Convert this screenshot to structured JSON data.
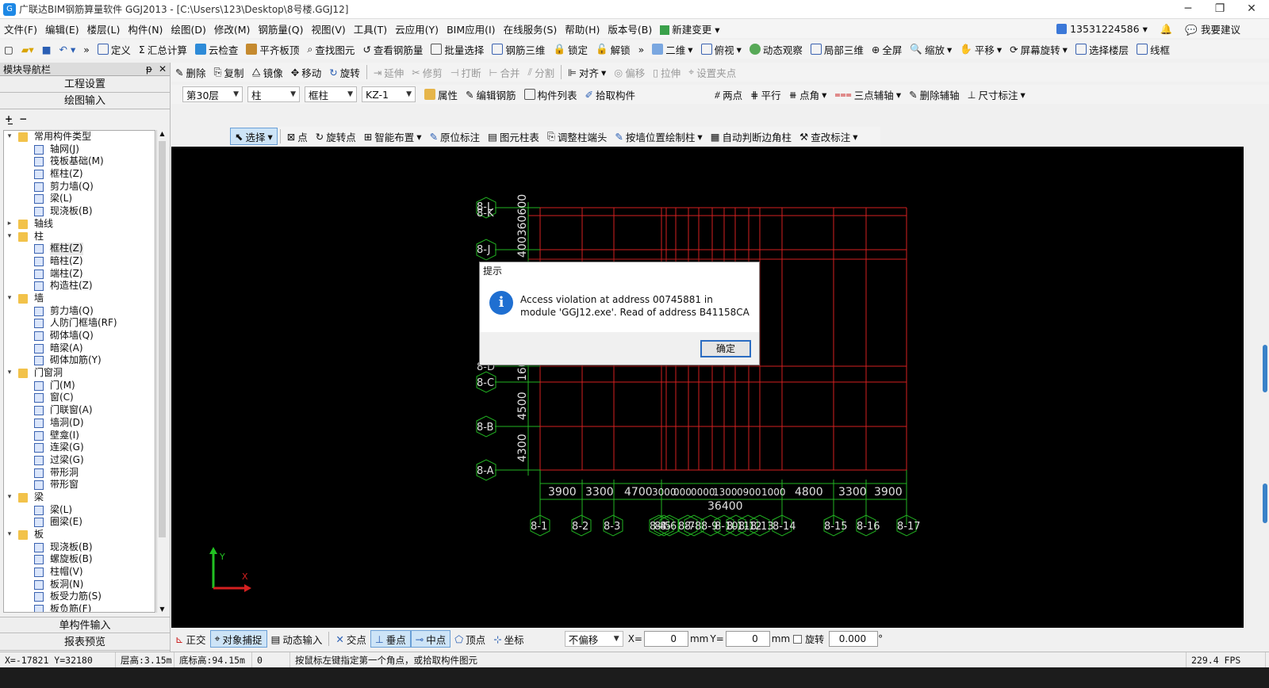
{
  "window": {
    "title": "广联达BIM钢筋算量软件 GGJ2013 - [C:\\Users\\123\\Desktop\\8号楼.GGJ12]",
    "minimize": "─",
    "restore": "❐",
    "close": "✕"
  },
  "menu": [
    "文件(F)",
    "编辑(E)",
    "楼层(L)",
    "构件(N)",
    "绘图(D)",
    "修改(M)",
    "钢筋量(Q)",
    "视图(V)",
    "工具(T)",
    "云应用(Y)",
    "BIM应用(I)",
    "在线服务(S)",
    "帮助(H)",
    "版本号(B)",
    "新建变更"
  ],
  "user": {
    "phone": "13531224586",
    "feedback": "我要建议"
  },
  "toolbar1": [
    "定义",
    "汇总计算",
    "云检查",
    "平齐板顶",
    "查找图元",
    "查看钢筋量",
    "批量选择",
    "钢筋三维",
    "锁定",
    "解锁",
    "二维",
    "俯视",
    "动态观察",
    "局部三维",
    "全屏",
    "缩放",
    "平移",
    "屏幕旋转",
    "选择楼层",
    "线框"
  ],
  "toolbar2": [
    "删除",
    "复制",
    "镜像",
    "移动",
    "旋转",
    "延伸",
    "修剪",
    "打断",
    "合并",
    "分割",
    "对齐",
    "偏移",
    "拉伸",
    "设置夹点"
  ],
  "toolbar3": {
    "floor": "第30层",
    "type": "柱",
    "subtype": "框柱",
    "element": "KZ-1",
    "buttons": [
      "属性",
      "编辑钢筋",
      "构件列表",
      "拾取构件"
    ],
    "axis_buttons": [
      "两点",
      "平行",
      "点角",
      "三点辅轴",
      "删除辅轴",
      "尺寸标注"
    ]
  },
  "toolbar4": [
    "选择",
    "点",
    "旋转点",
    "智能布置",
    "原位标注",
    "图元柱表",
    "调整柱端头",
    "按墙位置绘制柱",
    "自动判断边角柱",
    "查改标注"
  ],
  "leftpanel": {
    "title": "模块导航栏",
    "pin": "ᵽ",
    "close": "✕",
    "buttons_top": [
      "工程设置",
      "绘图输入"
    ],
    "buttons_bottom": [
      "单构件输入",
      "报表预览"
    ],
    "tree": [
      {
        "level": 0,
        "exp": "▾",
        "label": "常用构件类型",
        "folder": true
      },
      {
        "level": 1,
        "label": "轴网(J)"
      },
      {
        "level": 1,
        "label": "筏板基础(M)"
      },
      {
        "level": 1,
        "label": "框柱(Z)"
      },
      {
        "level": 1,
        "label": "剪力墙(Q)"
      },
      {
        "level": 1,
        "label": "梁(L)"
      },
      {
        "level": 1,
        "label": "现浇板(B)"
      },
      {
        "level": 0,
        "exp": "▸",
        "label": "轴线",
        "folder": true
      },
      {
        "level": 0,
        "exp": "▾",
        "label": "柱",
        "folder": true
      },
      {
        "level": 1,
        "label": "框柱(Z)",
        "selected": true
      },
      {
        "level": 1,
        "label": "暗柱(Z)"
      },
      {
        "level": 1,
        "label": "端柱(Z)"
      },
      {
        "level": 1,
        "label": "构造柱(Z)"
      },
      {
        "level": 0,
        "exp": "▾",
        "label": "墙",
        "folder": true
      },
      {
        "level": 1,
        "label": "剪力墙(Q)"
      },
      {
        "level": 1,
        "label": "人防门框墙(RF)"
      },
      {
        "level": 1,
        "label": "砌体墙(Q)"
      },
      {
        "level": 1,
        "label": "暗梁(A)"
      },
      {
        "level": 1,
        "label": "砌体加筋(Y)"
      },
      {
        "level": 0,
        "exp": "▾",
        "label": "门窗洞",
        "folder": true
      },
      {
        "level": 1,
        "label": "门(M)"
      },
      {
        "level": 1,
        "label": "窗(C)"
      },
      {
        "level": 1,
        "label": "门联窗(A)"
      },
      {
        "level": 1,
        "label": "墙洞(D)"
      },
      {
        "level": 1,
        "label": "壁龛(I)"
      },
      {
        "level": 1,
        "label": "连梁(G)"
      },
      {
        "level": 1,
        "label": "过梁(G)"
      },
      {
        "level": 1,
        "label": "带形洞"
      },
      {
        "level": 1,
        "label": "带形窗"
      },
      {
        "level": 0,
        "exp": "▾",
        "label": "梁",
        "folder": true
      },
      {
        "level": 1,
        "label": "梁(L)"
      },
      {
        "level": 1,
        "label": "圈梁(E)"
      },
      {
        "level": 0,
        "exp": "▾",
        "label": "板",
        "folder": true
      },
      {
        "level": 1,
        "label": "现浇板(B)"
      },
      {
        "level": 1,
        "label": "螺旋板(B)"
      },
      {
        "level": 1,
        "label": "柱帽(V)"
      },
      {
        "level": 1,
        "label": "板洞(N)"
      },
      {
        "level": 1,
        "label": "板受力筋(S)"
      },
      {
        "level": 1,
        "label": "板负筋(F)"
      }
    ]
  },
  "drawing": {
    "axis_top_dims_vertical": "400360600",
    "axis_left_labels": [
      "8-L",
      "8-K",
      "8-J",
      "8-D",
      "8-C",
      "8-B",
      "8-A"
    ],
    "left_dims": [
      "1600",
      "4500",
      "4300"
    ],
    "bottom_dims": [
      "3900",
      "3300",
      "4700",
      "3000",
      "000",
      "0000",
      "1300",
      "0900",
      "1000",
      "4800",
      "3300",
      "3900"
    ],
    "total_width": "36400",
    "bottom_axis_labels": [
      "8-1",
      "8-2",
      "8-3",
      "8-4",
      "8-5",
      "8-6",
      "8-7",
      "8-8",
      "8-9",
      "8-10",
      "8-11",
      "8-12",
      "8-13",
      "8-14",
      "8-15",
      "8-16",
      "8-17"
    ],
    "ucs_x": "X",
    "ucs_y": "Y"
  },
  "dialog": {
    "title": "提示",
    "message": "Access violation at address 00745881 in module 'GGJ12.exe'. Read of address B41158CA",
    "ok": "确定"
  },
  "snapbar": {
    "buttons": [
      "正交",
      "对象捕捉",
      "动态输入",
      "交点",
      "垂点",
      "中点",
      "顶点",
      "坐标"
    ],
    "offset_mode": "不偏移",
    "x_label": "X=",
    "x_value": "0",
    "y_label": "Y=",
    "y_value": "0",
    "unit": "mm",
    "rotate_label": "旋转",
    "rotate_value": "0.000",
    "degree": "°"
  },
  "status": {
    "coords": "X=-17821 Y=32180",
    "floor_height": "层高:3.15m",
    "base_height": "底标高:94.15m",
    "count": "0",
    "hint": "按鼠标左键指定第一个角点，或拾取构件图元",
    "fps": "229.4 FPS"
  }
}
